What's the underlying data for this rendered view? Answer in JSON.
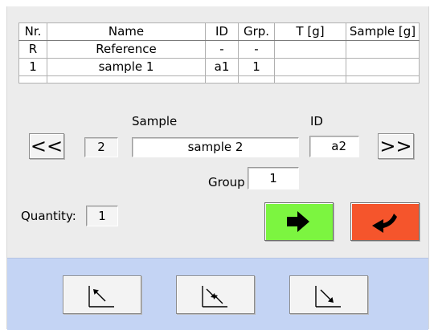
{
  "table": {
    "headers": [
      "Nr.",
      "Name",
      "ID",
      "Grp.",
      "T [g]",
      "Sample [g]"
    ],
    "rows": [
      [
        "R",
        "Reference",
        "-",
        "-",
        "",
        ""
      ],
      [
        "1",
        "sample 1",
        "a1",
        "1",
        "",
        ""
      ],
      [
        "",
        "",
        "",
        "",
        "",
        ""
      ]
    ]
  },
  "editor": {
    "prev_label": "<<",
    "next_label": ">>",
    "sample_label": "Sample",
    "id_label": "ID",
    "index_value": "2",
    "sample_name": "sample 2",
    "id_value": "a2",
    "group_label": "Group",
    "group_value": "1",
    "quantity_label": "Quantity:",
    "quantity_value": "1"
  },
  "actions": {
    "confirm_icon": "arrow-right-icon",
    "confirm_color": "#7cf540",
    "back_icon": "return-arrow-icon",
    "back_color": "#f5552c"
  },
  "bottom_bar": {
    "background": "#c4d4f4",
    "buttons": [
      "move-up-left-icon",
      "swap-diagonal-icon",
      "move-down-right-icon"
    ]
  }
}
